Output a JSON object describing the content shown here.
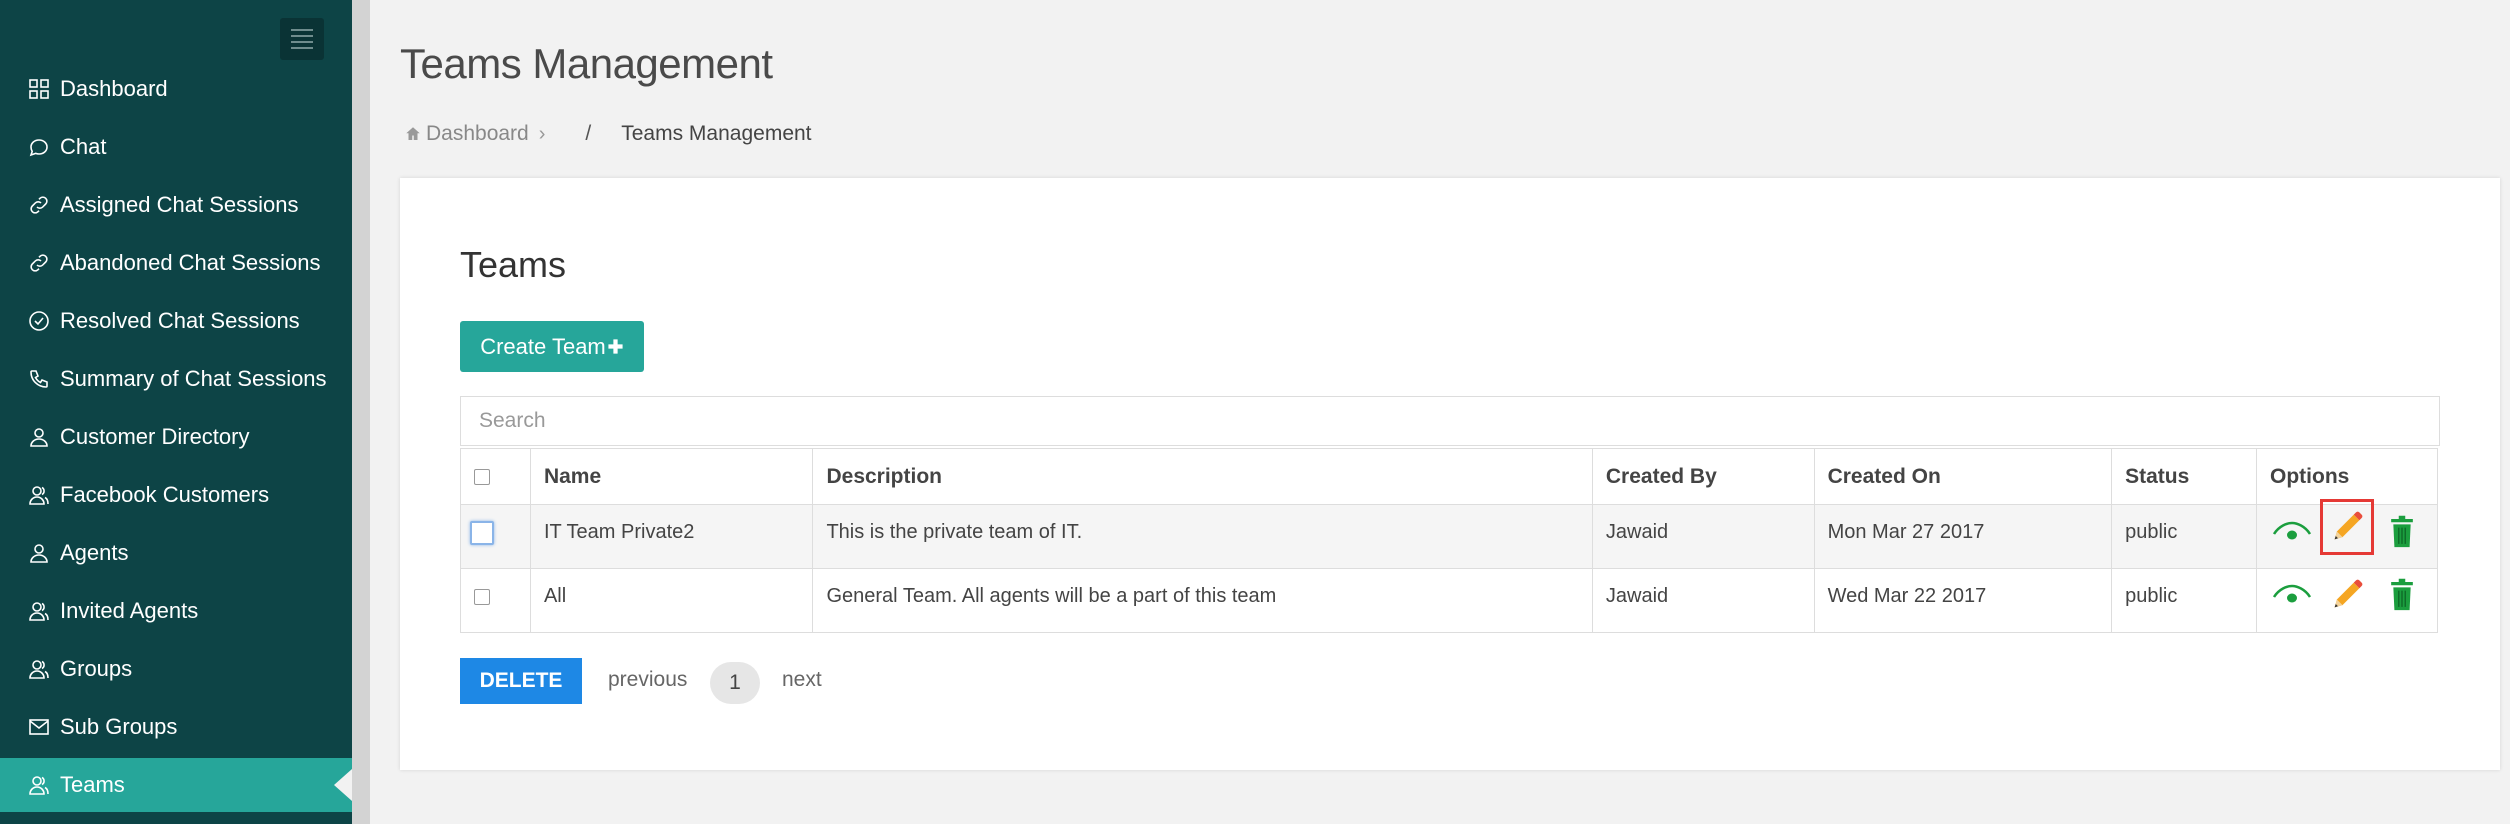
{
  "sidebar": {
    "items": [
      {
        "label": "Dashboard",
        "icon": "grid-icon"
      },
      {
        "label": "Chat",
        "icon": "chat-bubble-icon"
      },
      {
        "label": "Assigned Chat Sessions",
        "icon": "link-icon"
      },
      {
        "label": "Abandoned Chat Sessions",
        "icon": "link-icon"
      },
      {
        "label": "Resolved Chat Sessions",
        "icon": "check-circle-icon"
      },
      {
        "label": "Summary of Chat Sessions",
        "icon": "phone-icon"
      },
      {
        "label": "Customer Directory",
        "icon": "user-icon"
      },
      {
        "label": "Facebook Customers",
        "icon": "users-icon"
      },
      {
        "label": "Agents",
        "icon": "user-icon"
      },
      {
        "label": "Invited Agents",
        "icon": "users-icon"
      },
      {
        "label": "Groups",
        "icon": "users-icon"
      },
      {
        "label": "Sub Groups",
        "icon": "envelope-icon"
      },
      {
        "label": "Teams",
        "icon": "users-icon",
        "active": true
      }
    ]
  },
  "header": {
    "title": "Teams Management",
    "breadcrumb": {
      "home": "Dashboard",
      "separator": "/",
      "current": "Teams Management"
    }
  },
  "card": {
    "title": "Teams",
    "create_button": "Create Team",
    "search_placeholder": "Search",
    "table": {
      "columns": [
        "Name",
        "Description",
        "Created By",
        "Created On",
        "Status",
        "Options"
      ],
      "rows": [
        {
          "name": "IT Team Private2",
          "description": "This is the private team of IT.",
          "created_by": "Jawaid",
          "created_on": "Mon Mar 27 2017",
          "status": "public"
        },
        {
          "name": "All",
          "description": "General Team. All agents will be a part of this team",
          "created_by": "Jawaid",
          "created_on": "Wed Mar 22 2017",
          "status": "public"
        }
      ]
    },
    "delete_button": "DELETE",
    "pagination": {
      "previous": "previous",
      "page": "1",
      "next": "next"
    }
  },
  "colors": {
    "sidebar_bg": "#0d4446",
    "accent": "#26a69a",
    "delete_blue": "#1e88e5",
    "edit_orange": "#f5a623",
    "trash_green": "#1b9e3e",
    "highlight_red": "#e53935"
  }
}
